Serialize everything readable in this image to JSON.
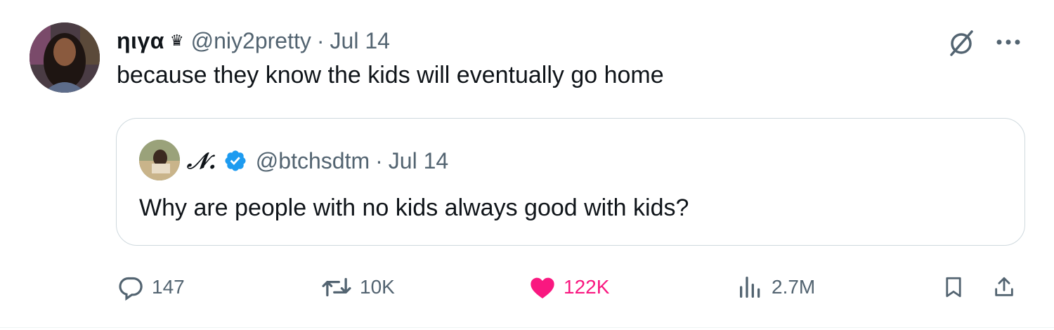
{
  "tweet": {
    "author": {
      "display_name": "ηιγα",
      "badge_icon": "crown-icon",
      "handle": "@niy2pretty",
      "separator": "·",
      "date": "Jul 14"
    },
    "text": "because they know the kids will eventually go home",
    "quote": {
      "display_name": "𝒩.",
      "verified": true,
      "handle": "@btchsdtm",
      "separator": "·",
      "date": "Jul 14",
      "text": "Why are people with no kids always good with kids?"
    },
    "actions": {
      "replies": "147",
      "reposts": "10K",
      "likes": "122K",
      "views": "2.7M"
    },
    "colors": {
      "like": "#f91880",
      "verified": "#1d9bf0",
      "secondary_text": "#536471",
      "border": "#cfd9de"
    }
  }
}
